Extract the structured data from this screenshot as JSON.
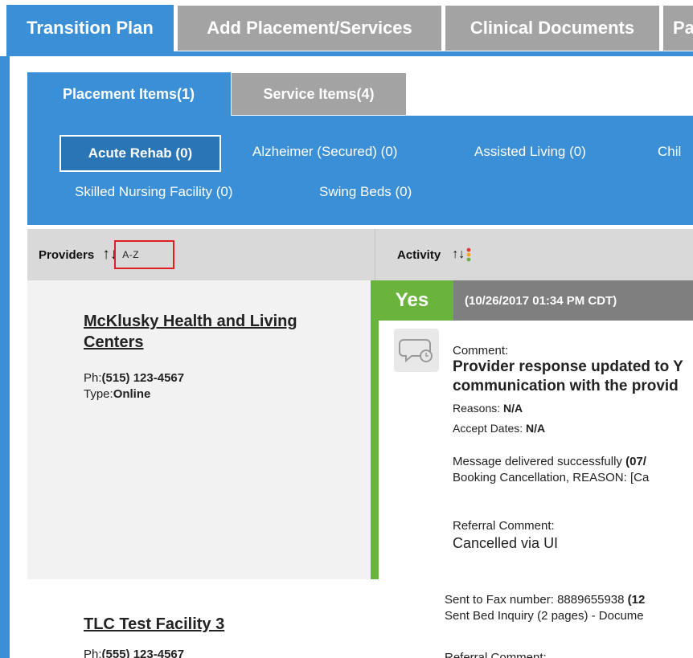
{
  "top_tabs": [
    {
      "label": "Transition Plan"
    },
    {
      "label": "Add Placement/Services"
    },
    {
      "label": "Clinical Documents"
    },
    {
      "label": "Pa"
    }
  ],
  "sub_tabs": [
    {
      "label": "Placement Items(1)"
    },
    {
      "label": "Service Items(4)"
    }
  ],
  "categories": [
    {
      "label": "Acute Rehab (0)"
    },
    {
      "label": "Alzheimer (Secured) (0)"
    },
    {
      "label": "Assisted Living (0)"
    },
    {
      "label": "Chil"
    },
    {
      "label": "Skilled Nursing Facility (0)"
    },
    {
      "label": "Swing Beds (0)"
    }
  ],
  "columns": {
    "providers": "Providers",
    "sort_arrows": "↑↓",
    "sort_az": "A-Z",
    "activity": "Activity"
  },
  "providers": [
    {
      "name_line1": "McKlusky Health and Living",
      "name_line2": "Centers",
      "phone_label": "Ph:",
      "phone": "(515) 123-4567",
      "type_label": "Type:",
      "type": "Online"
    },
    {
      "name_line1": "TLC Test Facility 3",
      "phone_label": "Ph:",
      "phone": "(555) 123-4567"
    }
  ],
  "activity": {
    "status": "Yes",
    "timestamp": "(10/26/2017 01:34 PM CDT)",
    "comment_label": "Comment:",
    "comment_line1": "Provider response updated to Y",
    "comment_line2": "communication with the provid",
    "reasons_label": "Reasons: ",
    "reasons": "N/A",
    "accept_label": "Accept Dates: ",
    "accept": "N/A",
    "msg_line1": "Message delivered successfully ",
    "msg_line1_bold": "(07/",
    "msg_line2": "Booking Cancellation, REASON: [Ca",
    "referral_label": "Referral Comment:",
    "referral_value": "Cancelled via UI",
    "fax_line1": "Sent to Fax number: 8889655938 ",
    "fax_line1_bold": "(12",
    "fax_line2": "Sent Bed Inquiry (2 pages) - Docume",
    "partial_line": "Referral Comment:"
  },
  "colors": {
    "accent": "#3a8fd6",
    "inactive_tab": "#a3a3a3",
    "yes_green": "#6ab43e",
    "sort_highlight": "#e02020"
  },
  "icons": {
    "comment": "comment-clock-icon",
    "sort": "sort-arrows-icon",
    "activity_sort": "sort-dots-icon"
  }
}
